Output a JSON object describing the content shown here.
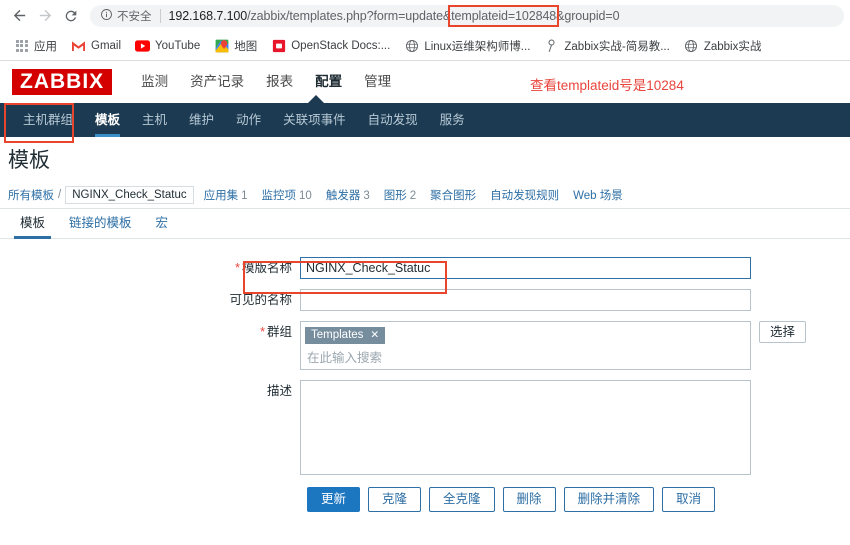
{
  "browser": {
    "nav": {
      "back_icon": "arrow-left-icon",
      "forward_icon": "arrow-right-icon",
      "reload_icon": "reload-icon"
    },
    "omnibox": {
      "security_icon": "info-circle-icon",
      "security_label": "不安全",
      "url_host": "192.168.7.100",
      "url_path": "/zabbix/templates.php?form=update&",
      "url_highlight": "templateid=102848",
      "url_tail": "&groupid=0",
      "full_url": "192.168.7.100/zabbix/templates.php?form=update&templateid=102848&groupid=0"
    },
    "bookmarks": [
      {
        "label": "应用",
        "icon": "apps-grid-icon"
      },
      {
        "label": "Gmail",
        "icon": "gmail-icon"
      },
      {
        "label": "YouTube",
        "icon": "youtube-icon"
      },
      {
        "label": "地图",
        "icon": "google-maps-icon"
      },
      {
        "label": "OpenStack Docs:...",
        "icon": "openstack-icon"
      },
      {
        "label": "Linux运维架构师博...",
        "icon": "globe-icon"
      },
      {
        "label": "Zabbix实战-简易教...",
        "icon": "bookmark-page-icon"
      },
      {
        "label": "Zabbix实战",
        "icon": "globe-icon"
      }
    ]
  },
  "zabbix": {
    "logo": "ZABBIX",
    "logo_color": "#d40000",
    "main_nav": [
      {
        "label": "监测",
        "active": false
      },
      {
        "label": "资产记录",
        "active": false
      },
      {
        "label": "报表",
        "active": false
      },
      {
        "label": "配置",
        "active": true
      },
      {
        "label": "管理",
        "active": false
      }
    ],
    "annotation": {
      "header_note": "查看templateid号是10284",
      "color": "#e8453c"
    },
    "sub_nav": [
      {
        "label": "主机群组",
        "active": false,
        "highlighted": true
      },
      {
        "label": "模板",
        "active": true
      },
      {
        "label": "主机",
        "active": false
      },
      {
        "label": "维护",
        "active": false
      },
      {
        "label": "动作",
        "active": false
      },
      {
        "label": "关联项事件",
        "active": false
      },
      {
        "label": "自动发现",
        "active": false
      },
      {
        "label": "服务",
        "active": false
      }
    ],
    "page_title": "模板",
    "breadcrumb": {
      "root": "所有模板",
      "separator": "/",
      "current": "NGINX_Check_Statuc",
      "links": [
        {
          "label": "应用集",
          "count": "1"
        },
        {
          "label": "监控项",
          "count": "10"
        },
        {
          "label": "触发器",
          "count": "3"
        },
        {
          "label": "图形",
          "count": "2"
        },
        {
          "label": "聚合图形",
          "count": ""
        },
        {
          "label": "自动发现规则",
          "count": ""
        },
        {
          "label": "Web 场景",
          "count": ""
        }
      ]
    },
    "tabs": [
      {
        "label": "模板",
        "active": true
      },
      {
        "label": "链接的模板",
        "active": false
      },
      {
        "label": "宏",
        "active": false
      }
    ],
    "form": {
      "template_name": {
        "label": "模版名称",
        "required": true,
        "value": "NGINX_Check_Statuc"
      },
      "visible_name": {
        "label": "可见的名称",
        "required": false,
        "value": "",
        "placeholder": ""
      },
      "groups": {
        "label": "群组",
        "required": true,
        "chip": "Templates",
        "chip_remove_icon": "close-x-icon",
        "placeholder": "在此输入搜索",
        "select_button": "选择"
      },
      "description": {
        "label": "描述",
        "required": false,
        "value": ""
      },
      "buttons": [
        {
          "label": "更新",
          "primary": true
        },
        {
          "label": "克隆",
          "primary": false
        },
        {
          "label": "全克隆",
          "primary": false
        },
        {
          "label": "删除",
          "primary": false
        },
        {
          "label": "删除并清除",
          "primary": false
        },
        {
          "label": "取消",
          "primary": false
        }
      ]
    }
  }
}
